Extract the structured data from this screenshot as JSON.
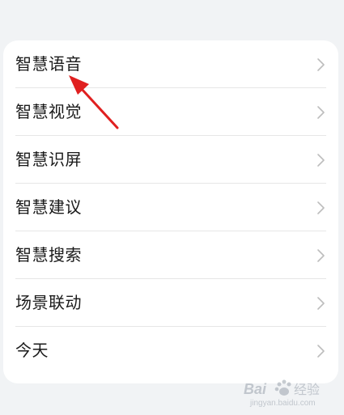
{
  "settings_list": {
    "items": [
      {
        "label": "智慧语音"
      },
      {
        "label": "智慧视觉"
      },
      {
        "label": "智慧识屏"
      },
      {
        "label": "智慧建议"
      },
      {
        "label": "智慧搜索"
      },
      {
        "label": "场景联动"
      },
      {
        "label": "今天"
      }
    ]
  },
  "icons": {
    "chevron": "chevron-right-icon",
    "annotation": "red-arrow-icon"
  },
  "watermark": {
    "text_main": "Bai",
    "text_cn": "经验",
    "text_url": "jingyan.baidu.com"
  },
  "colors": {
    "background": "#f1f3f5",
    "card": "#ffffff",
    "text": "#1a1a1a",
    "chevron": "#bdbdbd",
    "arrow": "#e02020"
  }
}
